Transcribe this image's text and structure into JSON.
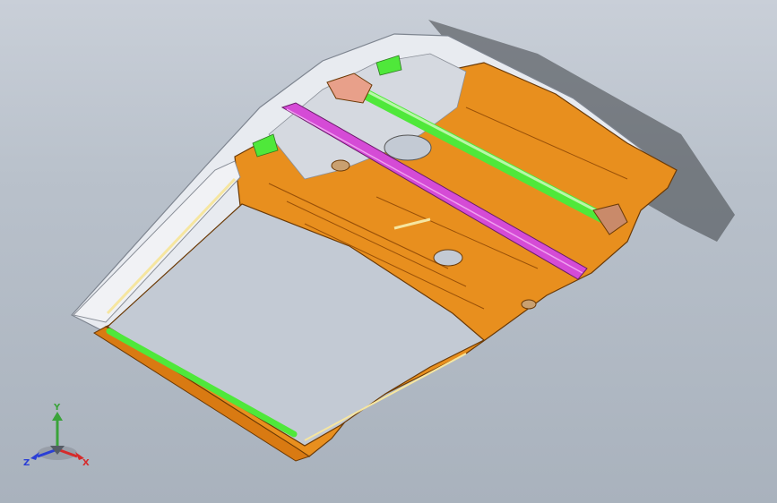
{
  "view": {
    "background_top": "#c9cfd8",
    "background_bottom": "#a9b2bd"
  },
  "model": {
    "panel_color": "#e88f1e",
    "panel_shade": "#c76f10",
    "frame_color": "#dfe3ea",
    "tube_color": "#4fe83a",
    "crossbar_color": "#d54bd6",
    "bracket_color": "#e8a08a"
  },
  "triad": {
    "x_label": "X",
    "y_label": "Y",
    "z_label": "Z",
    "x_color": "#d62b2b",
    "y_color": "#3aa33a",
    "z_color": "#2b3fd6"
  }
}
